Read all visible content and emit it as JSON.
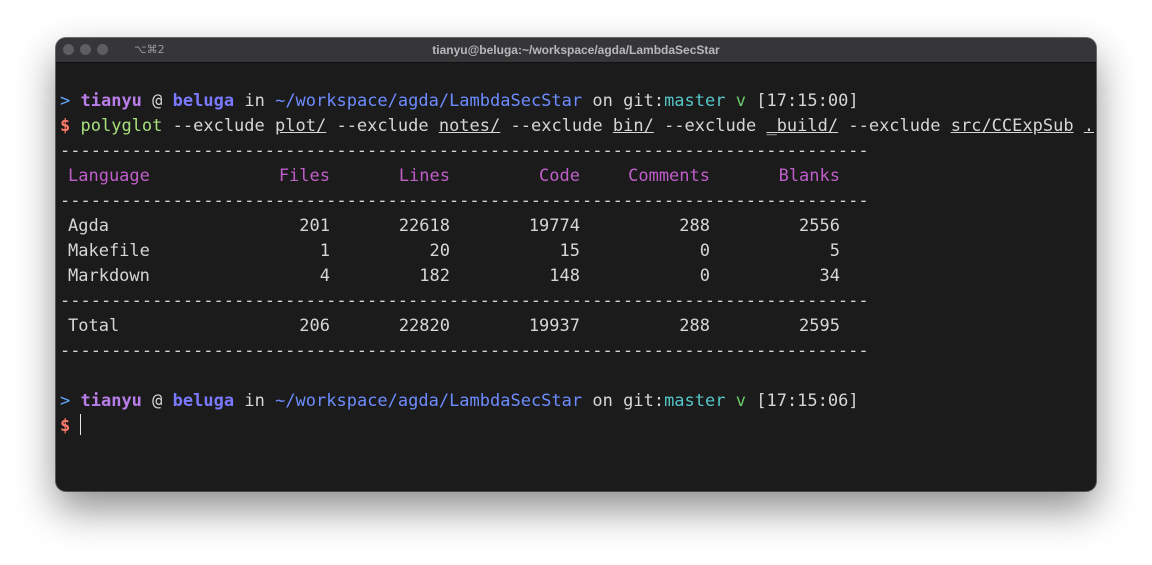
{
  "window": {
    "title": "tianyu@beluga:~/workspace/agda/LambdaSecStar",
    "tab_shortcut": "⌥⌘2"
  },
  "prompt1": {
    "arrow": ">",
    "user": "tianyu",
    "at": "@",
    "host": "beluga",
    "in": "in",
    "path": "~/workspace/agda/LambdaSecStar",
    "on": "on",
    "git": "git:",
    "branch": "master",
    "check": "v",
    "time": "[17:15:00]"
  },
  "command": {
    "dollar": "$",
    "program": "polyglot",
    "flag1": "--exclude",
    "arg1": "plot/",
    "flag2": "--exclude",
    "arg2": "notes/",
    "flag3": "--exclude",
    "arg3": "bin/",
    "flag4": "--exclude",
    "arg4": "_build/",
    "flag5": "--exclude",
    "arg5": "src/CCExpSub",
    "arg6": "."
  },
  "table": {
    "rule": "-------------------------------------------------------------------------------",
    "headers": [
      "Language",
      "Files",
      "Lines",
      "Code",
      "Comments",
      "Blanks"
    ],
    "rows": [
      [
        "Agda",
        "201",
        "22618",
        "19774",
        "288",
        "2556"
      ],
      [
        "Makefile",
        "1",
        "20",
        "15",
        "0",
        "5"
      ],
      [
        "Markdown",
        "4",
        "182",
        "148",
        "0",
        "34"
      ]
    ],
    "total": [
      "Total",
      "206",
      "22820",
      "19937",
      "288",
      "2595"
    ]
  },
  "prompt2": {
    "arrow": ">",
    "user": "tianyu",
    "at": "@",
    "host": "beluga",
    "in": "in",
    "path": "~/workspace/agda/LambdaSecStar",
    "on": "on",
    "git": "git:",
    "branch": "master",
    "check": "v",
    "time": "[17:15:06]"
  },
  "prompt3": {
    "dollar": "$"
  },
  "colors": {
    "background": "#1b1b1c",
    "user": "#b97de8",
    "host": "#7b79ff",
    "path": "#6d8cff",
    "branch": "#55c6c6",
    "command": "#a6e07a",
    "dollar": "#ff7a6a",
    "header": "#c05ec9"
  }
}
